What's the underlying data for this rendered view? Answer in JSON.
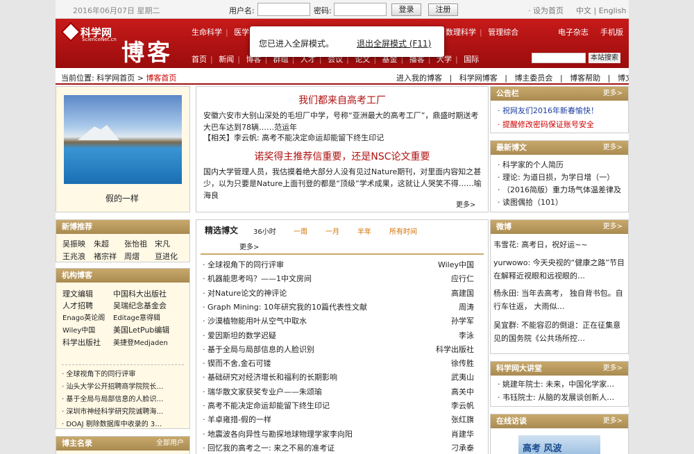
{
  "topbar": {
    "date": "2016年06月07日 星期二",
    "username_label": "用户名:",
    "password_label": "密码:",
    "login": "登录",
    "register": "注册",
    "set_home": "· 设为首页",
    "lang": "中文 | English"
  },
  "banner": {
    "logo_name": "科学网",
    "logo_sub": "ScienceNet.cn",
    "title": "博客",
    "nav1": [
      "生命科学",
      "医学"
    ],
    "nav1b": [
      "数理科学",
      "管理综合"
    ],
    "nav1r": [
      "电子杂志",
      "手机版"
    ],
    "nav2": [
      "首页",
      "新闻",
      "博客",
      "群组",
      "人才",
      "会议",
      "论文",
      "基金",
      "播客",
      "大学",
      "国际"
    ],
    "site_search": "本站搜索"
  },
  "fullscreen": {
    "msg": "您已进入全屏模式。",
    "exit": "退出全屏模式 (F11)"
  },
  "crumb": {
    "prefix": "当前位置: 科学网首页",
    "current": "博客首页",
    "links": [
      "进入我的博客",
      "|",
      "科学网博客",
      "|",
      "博主委员会",
      "|",
      "博客帮助",
      "|",
      "博文搜索"
    ]
  },
  "photo": {
    "caption": "假的一样"
  },
  "headline": {
    "title1": "我们都来自高考工厂",
    "text1": "安徽六安市大别山深处的毛坦厂中学，号称“亚洲最大的高考工厂”，鼎盛时期送考大巴车达到78辆……范运年",
    "related": "【相关】李云帆: 高考不能决定命运却能留下终生印记",
    "title2": "诺奖得主推荐信重要，还是NSC论文重要",
    "text2": "国内大学管理人员，我估摸着绝大部分人没有见过Nature期刊，对里面内容知之甚少，以为只要是Nature上面刊登的都是“顶级”学术成果，这就让人哭笑不得……喻海良",
    "more": "更多>"
  },
  "notice": {
    "title": "公告栏",
    "more": "更多>",
    "items": [
      "· 祝网友们2016年新春愉快！",
      "· 提醒修改密码保证账号安全"
    ]
  },
  "latest": {
    "title": "最新博文",
    "more": "更多>",
    "items": [
      "· 科学家的个人简历",
      "· 理论: 为道日损，为学日增（一）",
      "· （2016简版）重力场气体温差律及",
      "· 读图偶拾（101）"
    ]
  },
  "weibo": {
    "title": "微博",
    "more": "更多>",
    "items": [
      "韦雪花:  高考日，祝好运~~",
      "yurwowo:  今天央视的“健康之路”节目在解释近视眼和远视眼的…",
      "杨永田:  当年去高考，  独自背书包。自行车往返，  大雨似…",
      "吴宜群:  不能容忍的倒退：正在征集意见的国务院《公共场所控…"
    ]
  },
  "lecture": {
    "title": "科学网大讲堂",
    "more": "更多>",
    "items": [
      "· 姚建年院士: 未来，中国化学家…",
      "· 韦钰院士: 从脑的发展谈创新人…"
    ]
  },
  "interview": {
    "title": "在线访谈",
    "more": "更多>",
    "img_text": "高考 风波"
  },
  "newblog": {
    "title": "新博推荐",
    "names": [
      "吴振映",
      "朱超",
      "张怡祖",
      "宋凡",
      "王兆浪",
      "褚宗祥",
      "周熠",
      "亘进化"
    ]
  },
  "org": {
    "title": "机构博客",
    "items": [
      "理文编辑",
      "中国科大出版社",
      "人才招聘",
      "吴瑞纪念基金会",
      "Enago英论阁",
      "Editage意得辑",
      "Wiley中国",
      "美国LetPub编辑",
      "科学出版社",
      "美捷登Medjaden"
    ],
    "list": [
      "· 全球视角下的同行评审",
      "· 汕头大学公开招聘商学院院长…",
      "· 基于全局与局部信息的人脸识…",
      "· 深圳市神经科学研究院诚聘海…",
      "· DOAJ 剔除数据库中收录的 3…"
    ]
  },
  "bloggers": {
    "title": "博主名录",
    "all": "全部用户"
  },
  "featured": {
    "title": "精选博文",
    "tabs": [
      "36小时",
      "一周",
      "一月",
      "半年",
      "所有时间"
    ],
    "more": "更多>",
    "items": [
      {
        "t": "· 全球视角下的同行评审",
        "a": "Wiley中国"
      },
      {
        "t": "· 机器能思考吗？——1中文房间",
        "a": "应行仁"
      },
      {
        "t": "· 对Nature论文的神评论",
        "a": "高建国"
      },
      {
        "t": "· Graph Mining: 10年研究我的10篇代表性文献",
        "a": "周涛"
      },
      {
        "t": "· 沙漠植物能用叶从空气中取水",
        "a": "孙学军"
      },
      {
        "t": "· 爱因斯坦的数学迟疑",
        "a": "李泳"
      },
      {
        "t": "· 基于全局与局部信息的人脸识别",
        "a": "科学出版社"
      },
      {
        "t": "· 锲而不舍,金石可镂",
        "a": "徐传胜"
      },
      {
        "t": "· 基础研究对经济增长和福利的长期影响",
        "a": "武夷山"
      },
      {
        "t": "· 瑞华散文家获奖专业户——朱颂瑜",
        "a": "高关中"
      },
      {
        "t": "· 高考不能决定命运却能留下终生印记",
        "a": "李云帆"
      },
      {
        "t": "· 羊卓雍措-假的一样",
        "a": "张红旗"
      },
      {
        "t": "· 地震波各向异性与勘探地球物理学家李向阳",
        "a": "肖建华"
      },
      {
        "t": "· 回忆我的高考之一: 来之不易的准考证",
        "a": "刁承泰"
      }
    ]
  }
}
